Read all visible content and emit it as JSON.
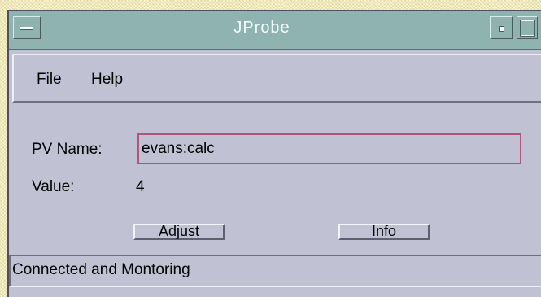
{
  "window": {
    "title": "JProbe"
  },
  "menubar": {
    "items": [
      {
        "label": "File"
      },
      {
        "label": "Help"
      }
    ]
  },
  "form": {
    "pv_name_label": "PV Name:",
    "pv_name_value": "evans:calc",
    "value_label": "Value:",
    "value": "4"
  },
  "buttons": {
    "adjust_label": "Adjust",
    "info_label": "Info"
  },
  "status": {
    "text": "Connected and Montoring"
  },
  "colors": {
    "titlebar": "#8fb3b1",
    "window_bg": "#c0c2d4",
    "input_border": "#b2557c",
    "desktop": "#fbf6d2"
  },
  "icons": {
    "window_menu": "window-menu-icon",
    "minimize": "minimize-icon",
    "maximize": "maximize-icon"
  }
}
